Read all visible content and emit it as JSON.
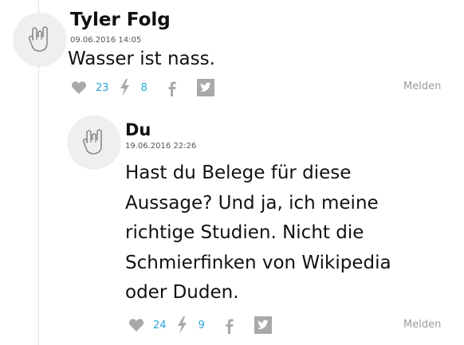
{
  "comments": [
    {
      "author": "Tyler Folg",
      "date": "09.06.2016 14:05",
      "text": "Wasser ist nass.",
      "likes": "23",
      "boosts": "8",
      "report_label": "Melden"
    },
    {
      "author": "Du",
      "date": "19.06.2016 22:26",
      "text_lines": [
        "Hast du Belege für diese",
        "Aussage? Und ja, ich meine",
        "richtige Studien. Nicht die",
        "Schmierfinken von Wikipedia",
        "oder Duden."
      ],
      "likes": "24",
      "boosts": "9",
      "report_label": "Melden"
    }
  ],
  "colors": {
    "count": "#2aa3d8",
    "icon_gray": "#a9a9a9",
    "line": "#e6e6e6"
  },
  "icons": [
    "rock-hand-icon",
    "heart-icon",
    "lightning-icon",
    "facebook-icon",
    "twitter-icon"
  ]
}
